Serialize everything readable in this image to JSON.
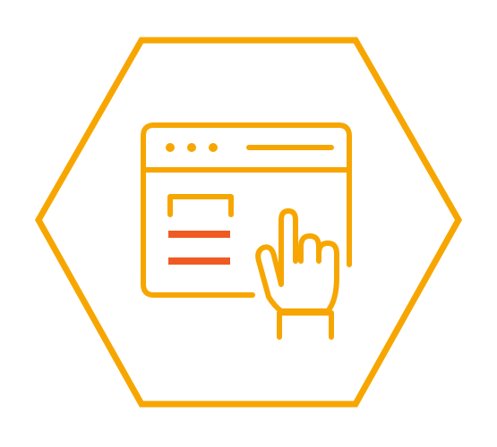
{
  "colors": {
    "primary": "#F7A600",
    "accent": "#F05A22",
    "background": "#FFFFFF"
  },
  "icons": {
    "frame": "hexagon-frame-icon",
    "window": "browser-window-icon",
    "pointer": "pointing-hand-icon",
    "content": "form-bars-icon"
  }
}
